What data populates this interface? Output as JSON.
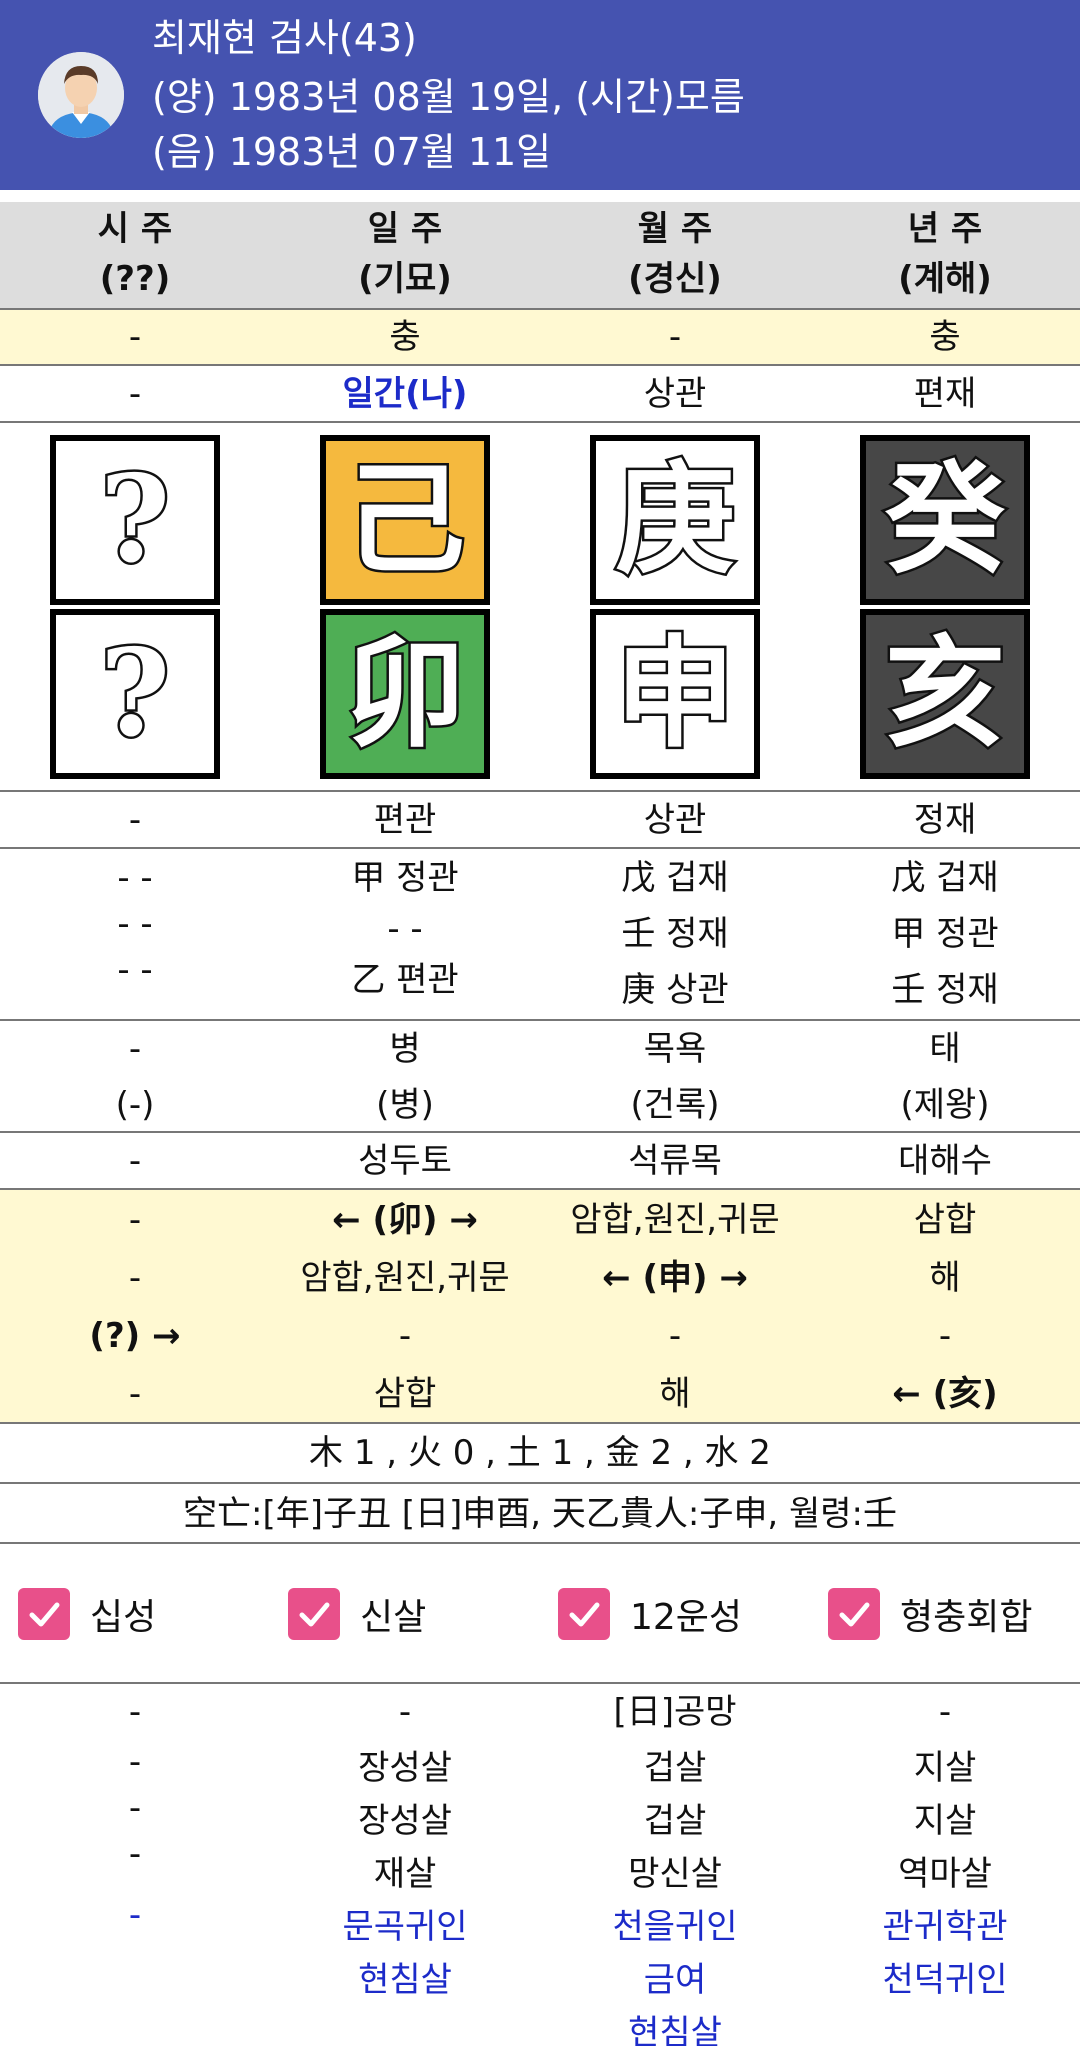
{
  "header": {
    "name_line": "최재현 검사(43)",
    "solar_line": "(양) 1983년 08월 19일, (시간)모름",
    "lunar_line": "(음) 1983년 07월 11일",
    "bg_color": "#4553b0"
  },
  "columns": [
    {
      "title": "시 주",
      "sub": "(??)"
    },
    {
      "title": "일 주",
      "sub": "(기묘)"
    },
    {
      "title": "월 주",
      "sub": "(경신)"
    },
    {
      "title": "년 주",
      "sub": "(계해)"
    }
  ],
  "clash_row": [
    "-",
    "충",
    "-",
    "충"
  ],
  "stem_god_row": [
    "-",
    "일간(나)",
    "상관",
    "편재"
  ],
  "stems": [
    {
      "char": "?",
      "style": "white"
    },
    {
      "char": "己",
      "style": "yellow"
    },
    {
      "char": "庚",
      "style": "white"
    },
    {
      "char": "癸",
      "style": "dark"
    }
  ],
  "branches": [
    {
      "char": "?",
      "style": "white"
    },
    {
      "char": "卯",
      "style": "green"
    },
    {
      "char": "申",
      "style": "white"
    },
    {
      "char": "亥",
      "style": "dark"
    }
  ],
  "branch_god_row": [
    "-",
    "편관",
    "상관",
    "정재"
  ],
  "hidden_stems": [
    [
      "- -",
      "- -",
      "- -"
    ],
    [
      "甲 정관",
      "- -",
      "乙 편관"
    ],
    [
      "戊 겁재",
      "壬 정재",
      "庚 상관"
    ],
    [
      "戊 겁재",
      "甲 정관",
      "壬 정재"
    ]
  ],
  "unseong": [
    [
      "-",
      "(-)"
    ],
    [
      "병",
      "(병)"
    ],
    [
      "목욕",
      "(건록)"
    ],
    [
      "태",
      "(제왕)"
    ]
  ],
  "napeum_row": [
    "-",
    "성두토",
    "석류목",
    "대해수"
  ],
  "relations": [
    [
      "-",
      "-",
      "(?) →",
      "-"
    ],
    [
      "← (卯) →",
      "암합,원진,귀문",
      "-",
      "삼합"
    ],
    [
      "암합,원진,귀문",
      "← (申) →",
      "-",
      "해"
    ],
    [
      "삼합",
      "해",
      "-",
      "← (亥)"
    ]
  ],
  "oheng_line": "木 1 , 火 0 , 土 1 , 金 2 , 水 2",
  "gongmang_line": "空亡:[年]子丑 [日]申酉, 天乙貴人:子申, 월령:壬",
  "checkboxes": [
    {
      "label": "십성",
      "checked": true
    },
    {
      "label": "신살",
      "checked": true
    },
    {
      "label": "12운성",
      "checked": true
    },
    {
      "label": "형충회합",
      "checked": true
    }
  ],
  "sinsal": [
    {
      "black": [
        "-",
        "-",
        "-",
        "-"
      ],
      "blue": [
        "-"
      ]
    },
    {
      "black": [
        "-",
        "장성살",
        "장성살",
        "재살"
      ],
      "blue": [
        "문곡귀인",
        "현침살"
      ]
    },
    {
      "black": [
        "[日]공망",
        "겁살",
        "겁살",
        "망신살"
      ],
      "blue": [
        "천을귀인",
        "금여",
        "현침살"
      ]
    },
    {
      "black": [
        "-",
        "지살",
        "지살",
        "역마살"
      ],
      "blue": [
        "관귀학관",
        "천덕귀인"
      ]
    }
  ],
  "colors": {
    "header": "#4553b0",
    "highlight_row": "#fff9d2",
    "checkbox": "#e8508a",
    "blue_text": "#1c2bc9",
    "earth_yellow": "#f5b93e",
    "wood_green": "#4fae55",
    "water_dark": "#474747"
  }
}
